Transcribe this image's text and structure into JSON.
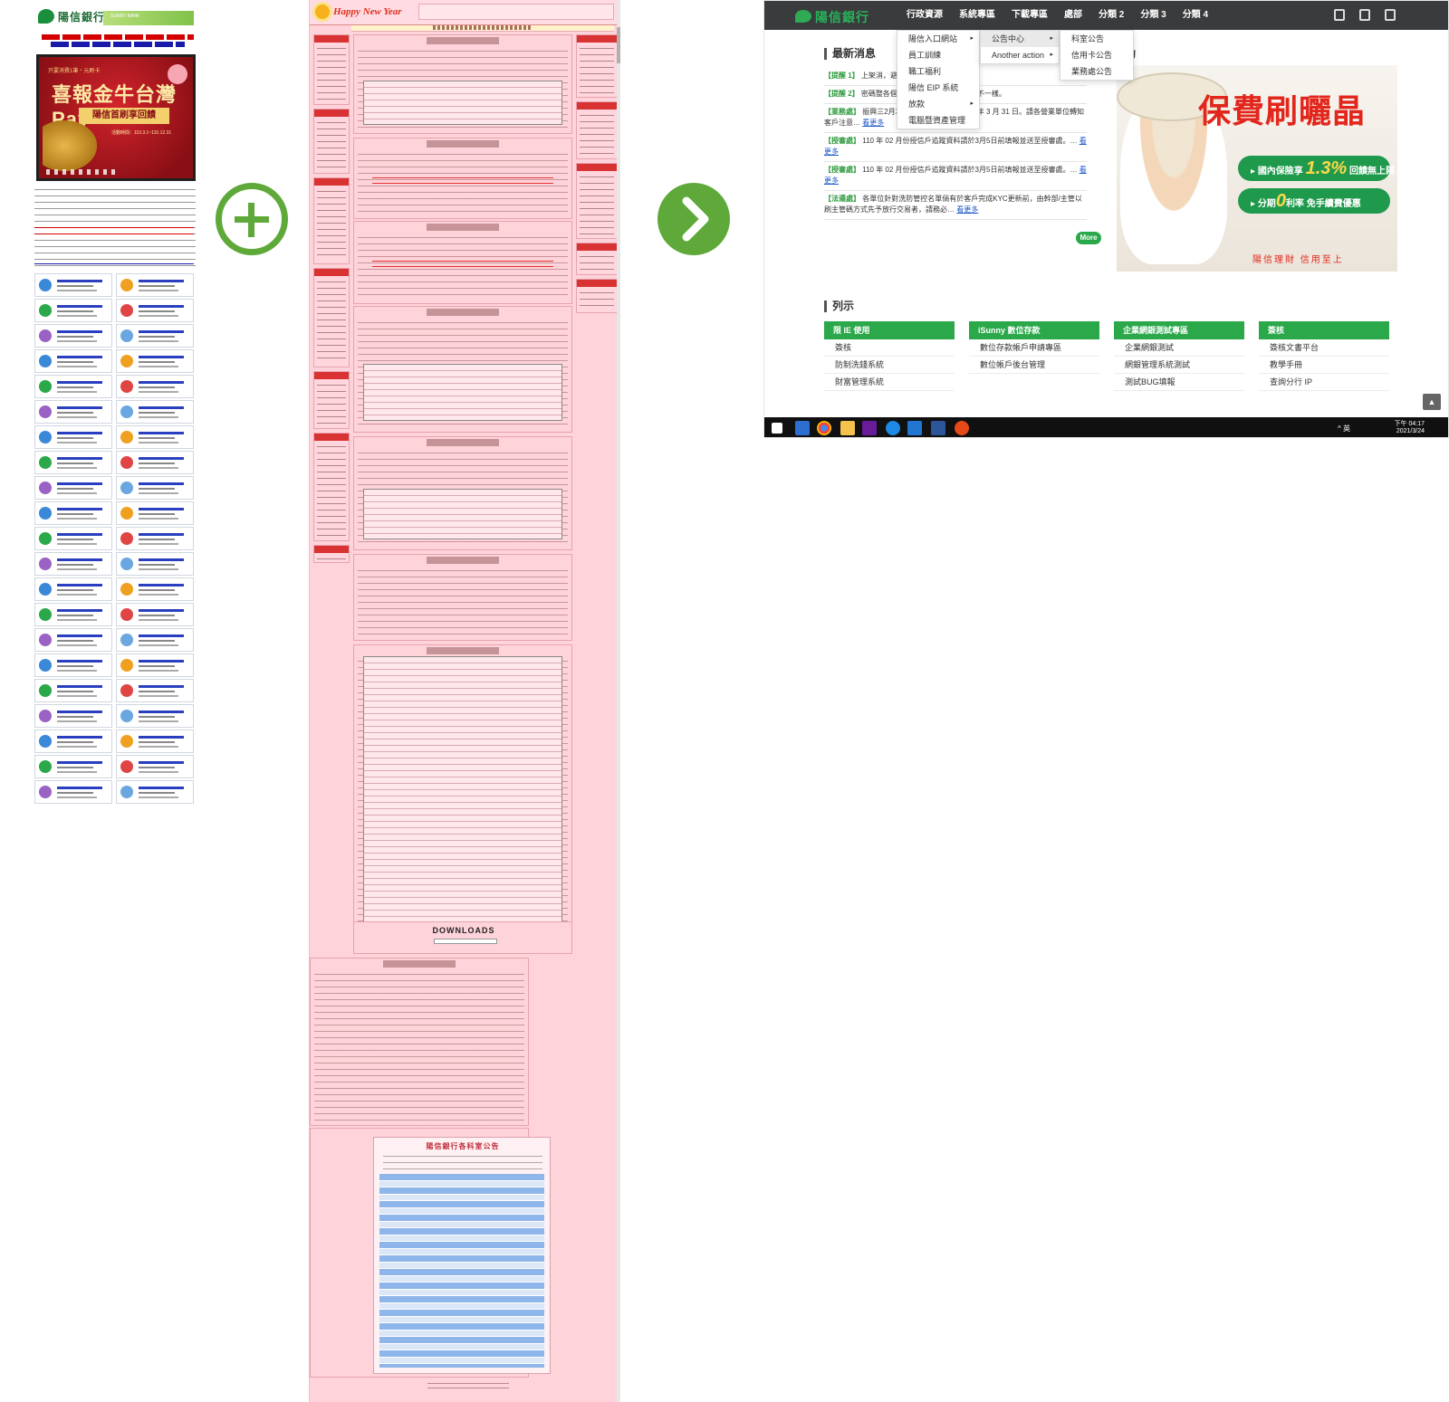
{
  "panel1": {
    "logo_text": "陽信銀行",
    "logo_sub": "SUNNY BANK",
    "banner": {
      "line1": "只要消費1筆・元刷卡",
      "line2": "喜報金牛台灣Pay",
      "line3": "陽信首刷享回饋",
      "line4": "活動時間：110.3.1~110.12.31"
    }
  },
  "panel2": {
    "header_title": "Happy New Year",
    "downloads_label": "DOWNLOADS",
    "bulletin_title": "陽信銀行各科室公告"
  },
  "panel3": {
    "brand": "陽信銀行",
    "nav": [
      "行政資源",
      "系統專區",
      "下載專區",
      "處部",
      "分類 2",
      "分類 3",
      "分類 4"
    ],
    "latest_news_title": "最新消息",
    "activity_title": "活動",
    "news": [
      {
        "tag": "【提醒 1】",
        "text": "上架消",
        "tail": "，避免造成困擾。",
        "more": ""
      },
      {
        "tag": "【提醒 2】",
        "text": "密碼整",
        "tail": "各個系統都要登入，且密碼還不一樣。",
        "more": ""
      },
      {
        "tag": "【業務處】",
        "text": "振興三",
        "tail": "2月31日，店家可兌換至 110 年 3 月 31 日。請各營業單位轉知客戶注意…",
        "more": "看更多"
      },
      {
        "tag": "【授審處】",
        "text": "110 年 02 月份授信戶追蹤資料請於3月5日前填報並送至授審處。…",
        "tail": "",
        "more": "看更多"
      },
      {
        "tag": "【授審處】",
        "text": "110 年 02 月份授信戶追蹤資料請於3月5日前填報並送至授審處。…",
        "tail": "",
        "more": "看更多"
      },
      {
        "tag": "【法遵處】",
        "text": "各單位針對洗防管控名單倘有於客戶完成KYC更新前，由幹部/主管以刷主管碼方式先予放行交易者，請務必…",
        "tail": "",
        "more": "看更多"
      }
    ],
    "more_button": "More",
    "promo": {
      "headline": "保費刷曬晶",
      "pill1_pre": "國內保險享",
      "pill1_num": "1.3%",
      "pill1_post": "回饋無上限",
      "pill2_pre": "分期",
      "pill2_num": "0",
      "pill2_post": "利率 免手續費優惠",
      "slogan": "陽信理財 信用至上"
    },
    "list_title": "列示",
    "categories": [
      {
        "header": "限 IE 使用",
        "items": [
          "簽核",
          "防制洗錢系統",
          "財富管理系統"
        ]
      },
      {
        "header": "iSunny 數位存款",
        "items": [
          "數位存款帳戶申請專區",
          "數位帳戶後台管理"
        ]
      },
      {
        "header": "企業網銀測試專區",
        "items": [
          "企業網銀測試",
          "網銀管理系統測試",
          "測試BUG填報"
        ]
      },
      {
        "header": "簽核",
        "items": [
          "簽核文書平台",
          "教學手冊",
          "查詢分行 IP"
        ]
      }
    ],
    "dropdown1": [
      "陽信入口網站",
      "員工訓練",
      "職工福利",
      "陽信 EIP 系統",
      "放款",
      "電腦暨資產管理"
    ],
    "dropdown2": [
      "公告中心",
      "Another action"
    ],
    "dropdown3": [
      "科室公告",
      "信用卡公告",
      "業務處公告"
    ],
    "taskbar": {
      "time": "下午 04:17",
      "date": "2021/3/24",
      "tray_text": "^ 英"
    }
  }
}
